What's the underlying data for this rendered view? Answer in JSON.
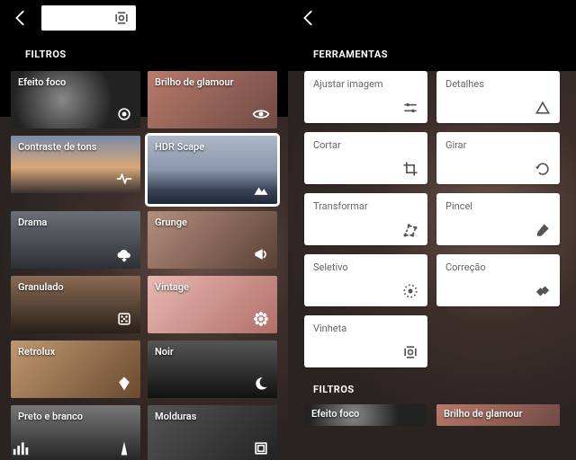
{
  "left": {
    "section": "FILTROS",
    "filters": [
      {
        "label": "Efeito foco",
        "icon": "target-icon",
        "thumb": "lens"
      },
      {
        "label": "Brilho de glamour",
        "icon": "eye-icon",
        "thumb": "warm"
      },
      {
        "label": "Contraste de tons",
        "icon": "pulse-icon",
        "thumb": "dusk"
      },
      {
        "label": "HDR Scape",
        "icon": "mountain-icon",
        "thumb": "sky",
        "selected": true
      },
      {
        "label": "Drama",
        "icon": "cloud-icon",
        "thumb": "storm"
      },
      {
        "label": "Grunge",
        "icon": "megaphone-icon",
        "thumb": "grunge"
      },
      {
        "label": "Granulado",
        "icon": "dice-icon",
        "thumb": "grain"
      },
      {
        "label": "Vintage",
        "icon": "flower-icon",
        "thumb": "vintage"
      },
      {
        "label": "Retrolux",
        "icon": "kite-icon",
        "thumb": "retro"
      },
      {
        "label": "Noir",
        "icon": "moon-icon",
        "thumb": "noir"
      },
      {
        "label": "Preto e branco",
        "icon": "tower-icon",
        "thumb": "bw"
      },
      {
        "label": "Molduras",
        "icon": "frame-icon",
        "thumb": "frame"
      }
    ]
  },
  "right": {
    "section1": "FERRAMENTAS",
    "tools": [
      {
        "label": "Ajustar imagem",
        "icon": "sliders-icon"
      },
      {
        "label": "Detalhes",
        "icon": "triangle-icon"
      },
      {
        "label": "Cortar",
        "icon": "crop-icon"
      },
      {
        "label": "Girar",
        "icon": "rotate-icon"
      },
      {
        "label": "Transformar",
        "icon": "transform-icon"
      },
      {
        "label": "Pincel",
        "icon": "brush-icon"
      },
      {
        "label": "Seletivo",
        "icon": "selective-icon"
      },
      {
        "label": "Correção",
        "icon": "healing-icon"
      },
      {
        "label": "Vinheta",
        "icon": "vignette-icon"
      }
    ],
    "section2": "FILTROS",
    "filters2": [
      {
        "label": "Efeito foco"
      },
      {
        "label": "Brilho de glamour"
      }
    ]
  }
}
